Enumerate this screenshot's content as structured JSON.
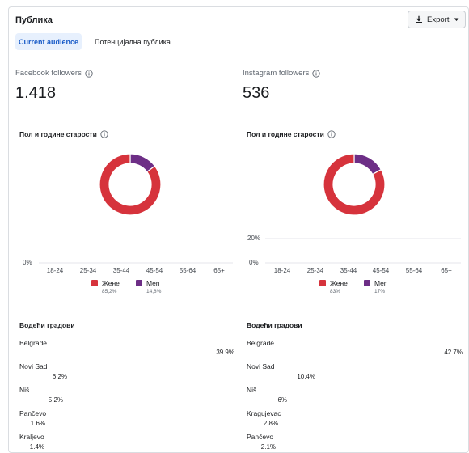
{
  "header": {
    "title": "Публика",
    "export_label": "Export"
  },
  "tabs": [
    {
      "label": "Current audience",
      "active": true
    },
    {
      "label": "Потенцијална публика",
      "active": false
    }
  ],
  "facebook": {
    "followers_label": "Facebook followers",
    "followers_value": "1.418",
    "age_gender_label": "Пол и године старости",
    "donut": {
      "women_fraction": 0.852,
      "men_fraction": 0.148
    },
    "legend": [
      {
        "label": "Жене",
        "pct": "85,2%"
      },
      {
        "label": "Men",
        "pct": "14,8%"
      }
    ],
    "y_ticks": [
      "0%"
    ],
    "age_groups": [
      "18-24",
      "25-34",
      "35-44",
      "45-54",
      "55-64",
      "65+"
    ],
    "cities_title": "Водећи градови",
    "cities": [
      {
        "name": "Belgrade",
        "pct": "39.9%",
        "value": 39.9
      },
      {
        "name": "Novi Sad",
        "pct": "6.2%",
        "value": 6.2
      },
      {
        "name": "Niš",
        "pct": "5.2%",
        "value": 5.2
      },
      {
        "name": "Pančevo",
        "pct": "1.6%",
        "value": 1.6
      },
      {
        "name": "Kraljevo",
        "pct": "1.4%",
        "value": 1.4
      }
    ]
  },
  "instagram": {
    "followers_label": "Instagram followers",
    "followers_value": "536",
    "age_gender_label": "Пол и године старости",
    "donut": {
      "women_fraction": 0.83,
      "men_fraction": 0.17
    },
    "legend": [
      {
        "label": "Жене",
        "pct": "83%"
      },
      {
        "label": "Men",
        "pct": "17%"
      }
    ],
    "y_ticks": [
      "20%",
      "0%"
    ],
    "age_groups": [
      "18-24",
      "25-34",
      "35-44",
      "45-54",
      "55-64",
      "65+"
    ],
    "cities_title": "Водећи градови",
    "cities": [
      {
        "name": "Belgrade",
        "pct": "42.7%",
        "value": 42.7
      },
      {
        "name": "Novi Sad",
        "pct": "10.4%",
        "value": 10.4
      },
      {
        "name": "Niš",
        "pct": "6%",
        "value": 6
      },
      {
        "name": "Kragujevac",
        "pct": "2.8%",
        "value": 2.8
      },
      {
        "name": "Pančevo",
        "pct": "2.1%",
        "value": 2.1
      }
    ]
  },
  "colors": {
    "women": "#d6333c",
    "men": "#6d2e86",
    "accent_blue": "#1a5cc8",
    "tab_bg": "#e7f0fd"
  }
}
